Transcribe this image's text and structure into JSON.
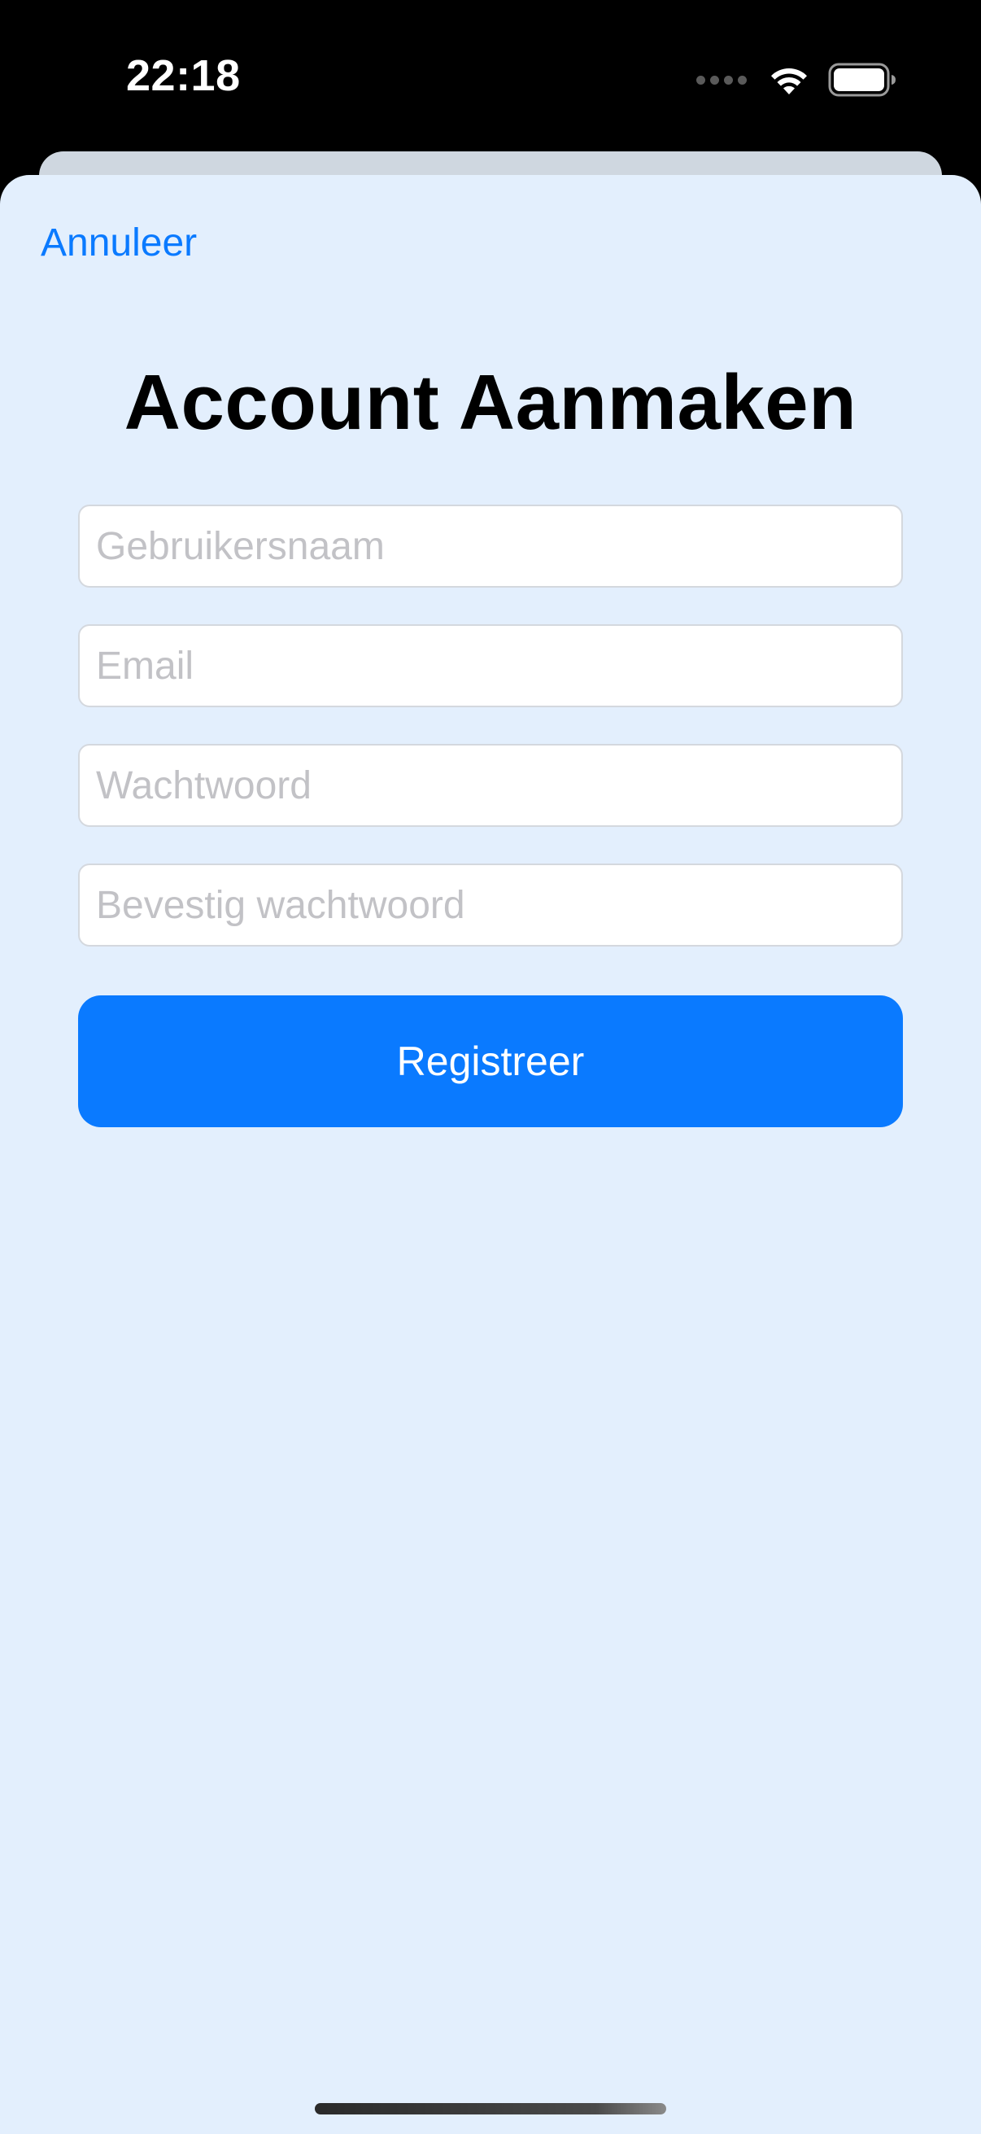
{
  "status_bar": {
    "time": "22:18",
    "icons": [
      "cellular-signal-icon",
      "wifi-icon",
      "battery-icon"
    ]
  },
  "header": {
    "cancel_label": "Annuleer"
  },
  "main": {
    "title": "Account Aanmaken",
    "fields": {
      "username": {
        "placeholder": "Gebruikersnaam",
        "value": ""
      },
      "email": {
        "placeholder": "Email",
        "value": ""
      },
      "password": {
        "placeholder": "Wachtwoord",
        "value": ""
      },
      "confirm_password": {
        "placeholder": "Bevestig wachtwoord",
        "value": ""
      }
    },
    "register_label": "Registreer"
  },
  "colors": {
    "accent": "#0a7aff",
    "sheet_background": "#e3effd",
    "placeholder_text": "#c2c2c6"
  }
}
